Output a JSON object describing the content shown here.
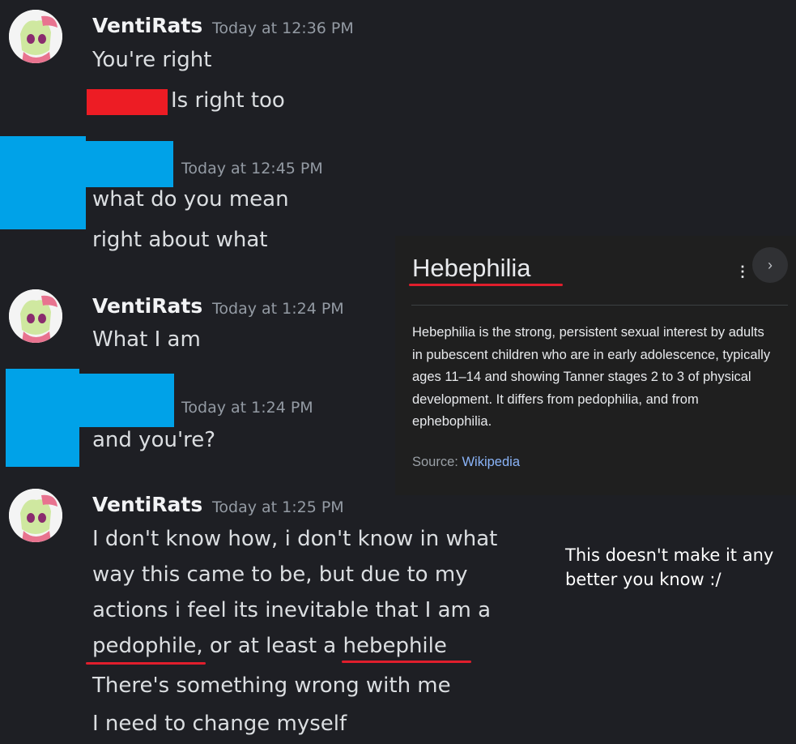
{
  "messages": [
    {
      "username": "VentiRats",
      "timestamp": "Today at 12:36 PM",
      "lines": [
        "You're right",
        "Is right too"
      ]
    },
    {
      "username": "",
      "timestamp": "Today at 12:45 PM",
      "lines": [
        "what do you mean",
        "right about what"
      ]
    },
    {
      "username": "VentiRats",
      "timestamp": "Today at 1:24 PM",
      "lines": [
        "What I am"
      ]
    },
    {
      "username": "",
      "timestamp": "Today at 1:24 PM",
      "lines": [
        "and you're?"
      ]
    },
    {
      "username": "VentiRats",
      "timestamp": "Today at 1:25 PM",
      "lines": [
        "I don't know how, i don't know in what",
        "way this came to be, but due to my",
        "actions i feel its inevitable that I am a",
        "pedophile, or at least a hebephile",
        "There's something wrong with me",
        "I need to change myself"
      ]
    }
  ],
  "search_card": {
    "title": "Hebephilia",
    "menu_icon": "more-vert-icon",
    "next_icon": "chevron-right-icon",
    "body": "Hebephilia is the strong, persistent sexual interest by adults in pubescent children who are in early adolescence, typically ages 11–14 and showing Tanner stages 2 to 3 of physical development. It differs from pedophilia, and from ephebophilia.",
    "source_label": "Source:",
    "source_link": "Wikipedia"
  },
  "caption": "This doesn't make it any better you know :/",
  "colors": {
    "background": "#1e1f24",
    "redaction_red": "#ed1c24",
    "redaction_blue": "#00a2e8",
    "underline": "#e01e2c",
    "link": "#8ab4f8"
  }
}
